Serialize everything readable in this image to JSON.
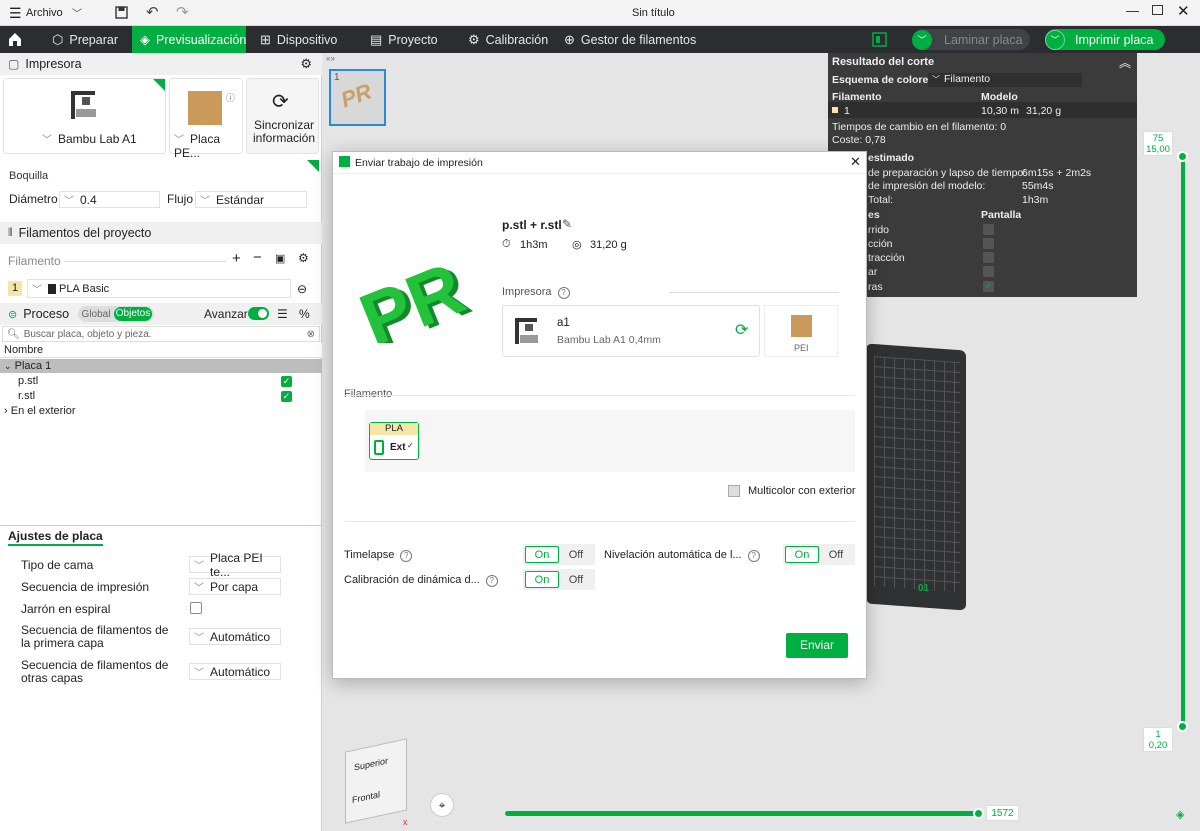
{
  "titlebar": {
    "menu_label": "Archivo",
    "title": "Sin título"
  },
  "nav": {
    "tabs": [
      "Preparar",
      "Previsualización",
      "Dispositivo",
      "Proyecto",
      "Calibración",
      "Gestor de filamentos"
    ],
    "laminar": "Laminar placa",
    "imprimir": "Imprimir placa"
  },
  "left": {
    "impresora_title": "Impresora",
    "printer_name": "Bambu Lab A1",
    "plate_name": "Placa PE...",
    "sync_label": "Sincronizar información",
    "boquilla_title": "Boquilla",
    "diametro_label": "Diámetro",
    "diametro_value": "0.4",
    "flujo_label": "Flujo",
    "flujo_value": "Estándar",
    "filamentos_title": "Filamentos del proyecto",
    "filamento_label": "Filamento",
    "fil_index": "1",
    "fil_name": "PLA Basic",
    "proceso_title": "Proceso",
    "global_label": "Global",
    "objetos_label": "Objetos",
    "avanzar_label": "Avanzar",
    "search_placeholder": "Buscar placa, objeto y pieza.",
    "col_nombre": "Nombre",
    "tree": [
      "Placa 1",
      "p.stl",
      "r.stl",
      "En el exterior"
    ],
    "ajustes_title": "Ajustes de placa",
    "settings": [
      {
        "label": "Tipo de cama",
        "value": "Placa PEI te..."
      },
      {
        "label": "Secuencia de impresión",
        "value": "Por capa"
      },
      {
        "label": "Jarrón en espiral",
        "value": ""
      },
      {
        "label": "Secuencia de filamentos de la primera capa",
        "value": "Automático"
      },
      {
        "label": "Secuencia de filamentos de otras capas",
        "value": "Automático"
      }
    ]
  },
  "plate_thumb_number": "1",
  "stats": {
    "title": "Resultado del corte",
    "esquema_label": "Esquema de colores",
    "esquema_value": "Filamento",
    "col_filamento": "Filamento",
    "col_modelo": "Modelo",
    "fil_index": "1",
    "fil_length": "10,30 m",
    "fil_weight": "31,20 g",
    "tiempos_label": "Tiempos de cambio en el filamento:",
    "tiempos_value": "0",
    "coste_label": "Coste:",
    "coste_value": "0,78",
    "estimado_title": "estimado",
    "prep_label": "de preparación y lapso de tiempo:",
    "prep_value": "6m15s + 2m2s",
    "impresion_label": "de impresión del modelo:",
    "impresion_value": "55m4s",
    "total_label": "Total:",
    "total_value": "1h3m",
    "col_es": "es",
    "col_pantalla": "Pantalla",
    "lines": [
      "rrido",
      "cción",
      "tracción",
      "ar",
      "ras"
    ]
  },
  "slider": {
    "top_layer": "75",
    "top_height": "15,00",
    "bottom_layer": "1",
    "bottom_height": "0,20",
    "h_value": "1572"
  },
  "cube": {
    "top": "Superior",
    "front": "Frontal"
  },
  "dialog": {
    "title": "Enviar trabajo de impresión",
    "filename": "p.stl + r.stl",
    "time": "1h3m",
    "weight": "31,20 g",
    "impresora_label": "Impresora",
    "printer_name": "a1",
    "printer_detail": "Bambu Lab A1 0,4mm",
    "plate_label": "PEI",
    "filamento_label": "Filamento",
    "fil_type": "PLA",
    "fil_slot": "Ext",
    "multicolor_label": "Multicolor con exterior",
    "timelapse_label": "Timelapse",
    "nivelacion_label": "Nivelación automática de l...",
    "calibracion_label": "Calibración de dinámica d...",
    "on_label": "On",
    "off_label": "Off",
    "send_label": "Enviar"
  },
  "colors": {
    "accent": "#00ae42",
    "nav_bg": "#2b2d30",
    "stats_bg": "#3b3b3b"
  }
}
